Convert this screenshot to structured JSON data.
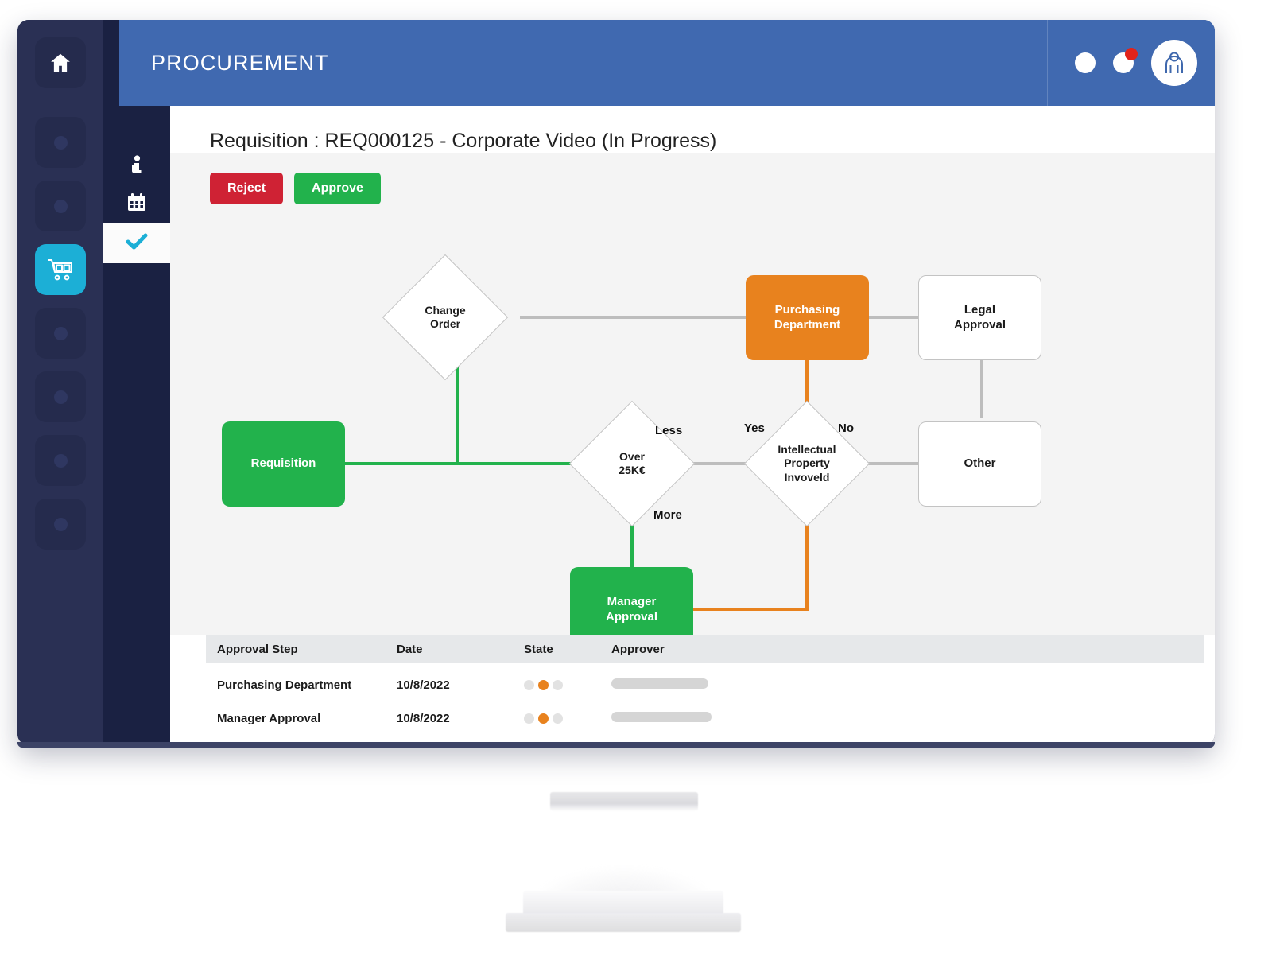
{
  "header": {
    "brand": "PROCUREMENT",
    "icons": [
      "circle-icon",
      "notification-circle-icon",
      "user-avatar-icon"
    ]
  },
  "sidebar": {
    "items": [
      {
        "name": "home",
        "icon": "home-icon",
        "active": false
      },
      {
        "name": "item-2",
        "icon": "dot-icon",
        "active": false
      },
      {
        "name": "item-3",
        "icon": "dot-icon",
        "active": false
      },
      {
        "name": "procurement",
        "icon": "shopping-cart-icon",
        "active": true
      },
      {
        "name": "item-5",
        "icon": "dot-icon",
        "active": false
      },
      {
        "name": "item-6",
        "icon": "dot-icon",
        "active": false
      },
      {
        "name": "item-7",
        "icon": "dot-icon",
        "active": false
      },
      {
        "name": "item-8",
        "icon": "dot-icon",
        "active": false
      }
    ],
    "sub_items": [
      {
        "name": "info",
        "icon": "info-icon",
        "active": false
      },
      {
        "name": "calendar",
        "icon": "calendar-icon",
        "active": false
      },
      {
        "name": "approvals",
        "icon": "check-icon",
        "active": true
      }
    ]
  },
  "main": {
    "page_title": "Requisition : REQ000125 - Corporate Video (In Progress)",
    "reject_label": "Reject",
    "approve_label": "Approve"
  },
  "flow": {
    "nodes": {
      "requisition": "Requisition",
      "change_order": "Change\nOrder",
      "change_order_l1": "Change",
      "change_order_l2": "Order",
      "over25k_l1": "Over",
      "over25k_l2": "25K€",
      "manager_approval_l1": "Manager",
      "manager_approval_l2": "Approval",
      "purchasing_l1": "Purchasing",
      "purchasing_l2": "Department",
      "ip_l1": "Intellectual",
      "ip_l2": "Property",
      "ip_l3": "Invoveld",
      "legal_l1": "Legal",
      "legal_l2": "Approval",
      "other": "Other"
    },
    "edge_labels": {
      "less": "Less",
      "more": "More",
      "yes": "Yes",
      "no": "No"
    },
    "colors": {
      "green": "#22b24c",
      "orange": "#e8821e",
      "gray": "#bdbdbd",
      "canvas": "#f4f4f4"
    }
  },
  "table": {
    "columns": [
      "Approval Step",
      "Date",
      "State",
      "Approver"
    ],
    "rows": [
      {
        "step": "Purchasing Department",
        "date": "10/8/2022",
        "state": [
          "#e2e2e2",
          "#e8821e",
          "#e2e2e2"
        ],
        "approver_width": 122
      },
      {
        "step": "Manager Approval",
        "date": "10/8/2022",
        "state": [
          "#e2e2e2",
          "#e8821e",
          "#e2e2e2"
        ],
        "approver_width": 126
      }
    ]
  }
}
